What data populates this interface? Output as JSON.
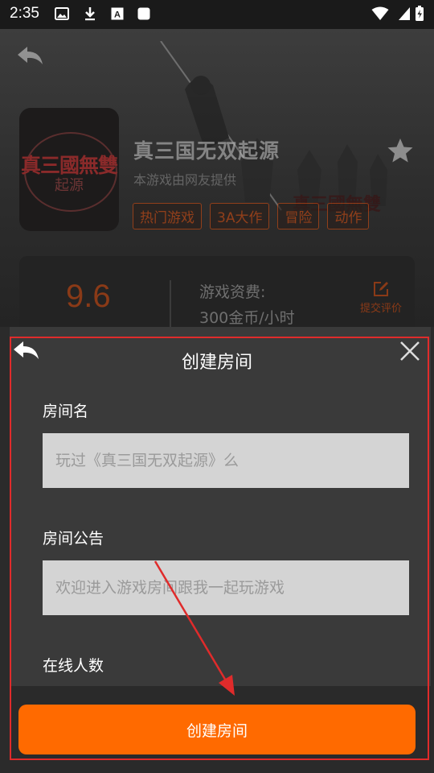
{
  "status_bar": {
    "time": "2:35",
    "icons": [
      "image-icon",
      "download-icon",
      "font-icon",
      "square-icon",
      "wifi-icon",
      "battery-icon"
    ]
  },
  "game": {
    "title": "真三国无双起源",
    "subtitle": "本游戏由网友提供",
    "tags": [
      "热门游戏",
      "3A大作",
      "冒险",
      "动作"
    ],
    "cover_logo_text": "真三國無雙",
    "cover_logo_sub": "起源",
    "watermark_text": "真三國無雙"
  },
  "info_card": {
    "score": "9.6",
    "fee_label": "游戏资费:",
    "fee_value": "300金币/小时",
    "review_label": "提交评价"
  },
  "modal": {
    "title": "创建房间",
    "room_name_label": "房间名",
    "room_name_placeholder": "玩过《真三国无双起源》么",
    "notice_label": "房间公告",
    "notice_placeholder": "欢迎进入游戏房间跟我一起玩游戏",
    "online_label": "在线人数",
    "create_button": "创建房间"
  },
  "colors": {
    "accent": "#ff6a00",
    "annotation": "#e02b2b",
    "modal_bg": "#3a3a3a",
    "input_bg": "#d4d4d4"
  }
}
